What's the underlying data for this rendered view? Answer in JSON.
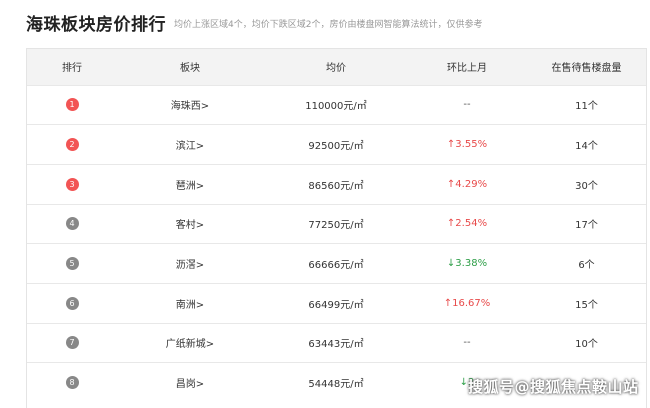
{
  "header": {
    "title": "海珠板块房价排行",
    "subtitle": "均价上涨区域4个，均价下跌区域2个，房价由楼盘网智能算法统计，仅供参考"
  },
  "table": {
    "columns": [
      "排行",
      "板块",
      "均价",
      "环比上月",
      "在售待售楼盘量"
    ],
    "rows": [
      {
        "rank": "1",
        "rank_color": "#f25454",
        "district": "海珠西>",
        "price": "110000元/㎡",
        "change": "--",
        "trend": "flat",
        "count": "11个"
      },
      {
        "rank": "2",
        "rank_color": "#f25454",
        "district": "滨江>",
        "price": "92500元/㎡",
        "change": "↑3.55%",
        "trend": "up",
        "count": "14个"
      },
      {
        "rank": "3",
        "rank_color": "#f25454",
        "district": "琶洲>",
        "price": "86560元/㎡",
        "change": "↑4.29%",
        "trend": "up",
        "count": "30个"
      },
      {
        "rank": "4",
        "rank_color": "#888888",
        "district": "客村>",
        "price": "77250元/㎡",
        "change": "↑2.54%",
        "trend": "up",
        "count": "17个"
      },
      {
        "rank": "5",
        "rank_color": "#888888",
        "district": "沥滘>",
        "price": "66666元/㎡",
        "change": "↓3.38%",
        "trend": "down",
        "count": "6个"
      },
      {
        "rank": "6",
        "rank_color": "#888888",
        "district": "南洲>",
        "price": "66499元/㎡",
        "change": "↑16.67%",
        "trend": "up",
        "count": "15个"
      },
      {
        "rank": "7",
        "rank_color": "#888888",
        "district": "广纸新城>",
        "price": "63443元/㎡",
        "change": "--",
        "trend": "flat",
        "count": "10个"
      },
      {
        "rank": "8",
        "rank_color": "#888888",
        "district": "昌岗>",
        "price": "54448元/㎡",
        "change": "↓2",
        "trend": "down",
        "count": ""
      }
    ]
  },
  "watermark": "搜狐号@搜狐焦点鞍山站",
  "colors": {
    "up": "#e84a4a",
    "down": "#2e9e48",
    "top_rank": "#f25454",
    "rank": "#888888"
  }
}
